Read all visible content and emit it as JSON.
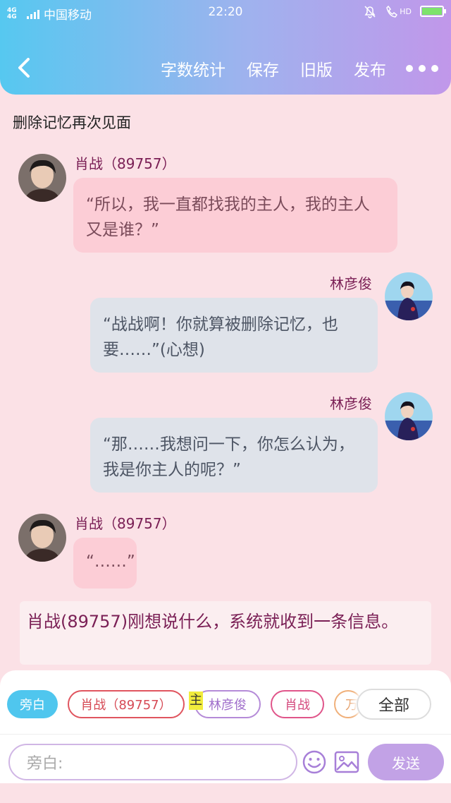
{
  "status_bar": {
    "network": "4G 4G",
    "carrier": "中国移动",
    "time": "22:20",
    "hd": "HD"
  },
  "nav": {
    "word_count": "字数统计",
    "save": "保存",
    "old_version": "旧版",
    "publish": "发布"
  },
  "story": {
    "title": "删除记忆再次见面"
  },
  "messages": [
    {
      "speaker": "肖战（89757）",
      "text": "“所以，我一直都找我的主人，我的主人又是谁？”"
    },
    {
      "speaker": "林彦俊",
      "text": "“战战啊！你就算被删除记忆，也要……”(心想)"
    },
    {
      "speaker": "林彦俊",
      "text": "“那……我想问一下，你怎么认为，我是你主人的呢？”"
    },
    {
      "speaker": "肖战（89757）",
      "text": "“……”"
    }
  ],
  "narration": "肖战(89757)刚想说什么，系统就收到一条信息。",
  "roles": {
    "narrator": "旁白",
    "xiaozhan_89757": "肖战（89757）",
    "highlight": "主",
    "lin": "林彦俊",
    "xiaozhan": "肖战",
    "partial": "万",
    "all": "全部"
  },
  "composer": {
    "placeholder": "旁白:",
    "send": "发送"
  },
  "colors": {
    "header_gradient": [
      "#56c8f0",
      "#c197ea"
    ],
    "page_bg": "#fbe1e6",
    "left_bubble": "#fccdd6",
    "right_bubble": "#dfe3ea",
    "speaker_text": "#7a1f55",
    "send_button": "#c2a2e6"
  }
}
